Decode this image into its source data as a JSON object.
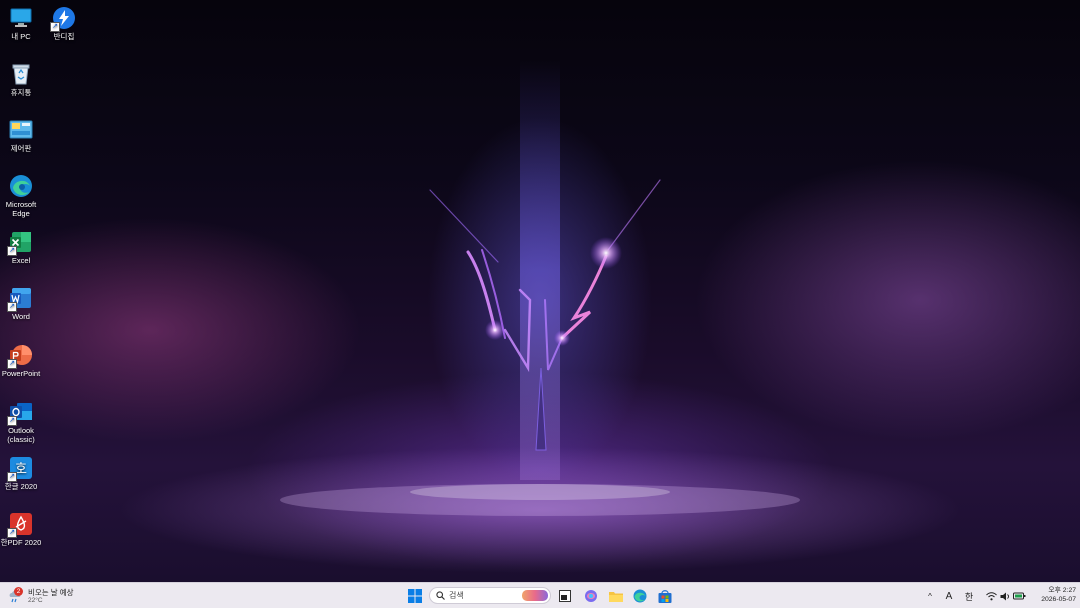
{
  "desktop": {
    "icons": [
      {
        "name": "pc",
        "label": "내 PC"
      },
      {
        "name": "bandizip",
        "label": "반디집"
      },
      {
        "name": "recycle-bin",
        "label": "휴지통"
      },
      {
        "name": "control-panel",
        "label": "제어판"
      },
      {
        "name": "edge",
        "label": "Microsoft Edge"
      },
      {
        "name": "excel",
        "label": "Excel"
      },
      {
        "name": "word",
        "label": "Word"
      },
      {
        "name": "powerpoint",
        "label": "PowerPoint"
      },
      {
        "name": "outlook",
        "label": "Outlook (classic)"
      },
      {
        "name": "hangul",
        "label": "한글 2020"
      },
      {
        "name": "hanpdf",
        "label": "한PDF 2020"
      }
    ]
  },
  "taskbar": {
    "weather": {
      "badge": "2",
      "text": "비오는 날 예상",
      "temp": "22°C",
      "icon": "weather-icon"
    },
    "start_icon": "windows-start-icon",
    "search": {
      "placeholder": "검색"
    },
    "pinned": [
      {
        "name": "task-view",
        "icon": "task-view-icon"
      },
      {
        "name": "copilot",
        "icon": "copilot-icon"
      },
      {
        "name": "file-explorer",
        "icon": "folder-icon"
      },
      {
        "name": "edge",
        "icon": "edge-icon"
      },
      {
        "name": "store",
        "icon": "store-icon"
      }
    ],
    "tray": {
      "chevron": "^",
      "font_indicator": "A",
      "ime": "한",
      "time": "오후 2:27",
      "date": "2026-05-07"
    }
  },
  "colors": {
    "taskbar_bg": "#ece9f0",
    "accent": "#0067c0"
  }
}
